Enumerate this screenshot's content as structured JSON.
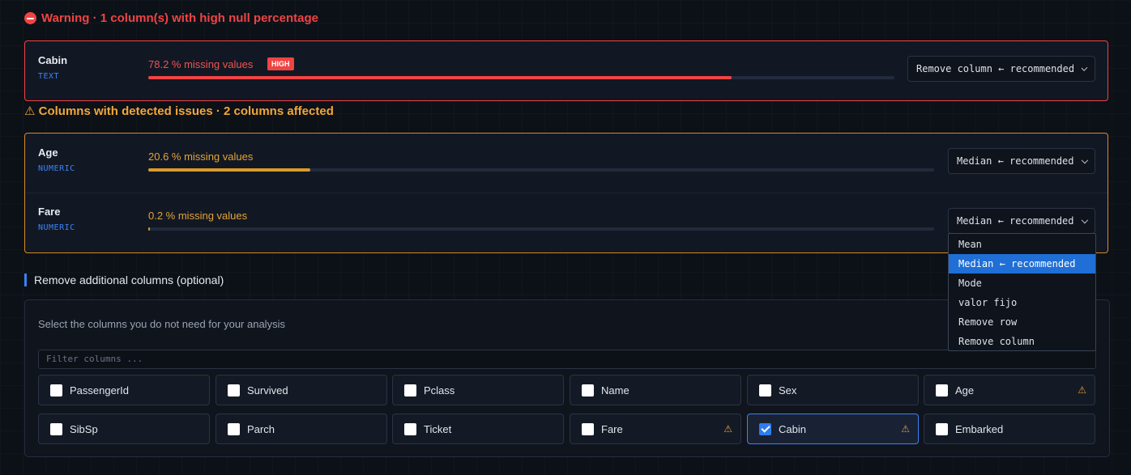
{
  "warning_section": {
    "title": "Warning · 1 column(s) with high null percentage",
    "columns": [
      {
        "name": "Cabin",
        "type": "TEXT",
        "missing_text": "78.2 % missing values",
        "missing_fraction": 0.782,
        "badge": "HIGH",
        "action": "Remove column ← recommended"
      }
    ]
  },
  "issues_section": {
    "title": "⚠ Columns with detected issues · 2 columns affected",
    "columns": [
      {
        "name": "Age",
        "type": "NUMERIC",
        "missing_text": "20.6 % missing values",
        "missing_fraction": 0.206,
        "action": "Median ← recommended"
      },
      {
        "name": "Fare",
        "type": "NUMERIC",
        "missing_text": "0.2 % missing values",
        "missing_fraction": 0.002,
        "action": "Median ← recommended"
      }
    ]
  },
  "dropdown": {
    "options": [
      "Mean",
      "Median ← recommended",
      "Mode",
      "valor fijo",
      "Remove row",
      "Remove column"
    ],
    "selected": "Median ← recommended"
  },
  "remove_section": {
    "title": "Remove additional columns (optional)",
    "hint": "Select the columns you do not need for your analysis",
    "filter_placeholder": "Filter columns ...",
    "columns": [
      {
        "name": "PassengerId",
        "checked": false,
        "warning": false
      },
      {
        "name": "Survived",
        "checked": false,
        "warning": false
      },
      {
        "name": "Pclass",
        "checked": false,
        "warning": false
      },
      {
        "name": "Name",
        "checked": false,
        "warning": false
      },
      {
        "name": "Sex",
        "checked": false,
        "warning": false
      },
      {
        "name": "Age",
        "checked": false,
        "warning": true
      },
      {
        "name": "SibSp",
        "checked": false,
        "warning": false
      },
      {
        "name": "Parch",
        "checked": false,
        "warning": false
      },
      {
        "name": "Ticket",
        "checked": false,
        "warning": false
      },
      {
        "name": "Fare",
        "checked": false,
        "warning": true
      },
      {
        "name": "Cabin",
        "checked": true,
        "warning": true
      },
      {
        "name": "Embarked",
        "checked": false,
        "warning": false
      }
    ],
    "warning_glyph": "⚠"
  },
  "colors": {
    "danger": "#ef4444",
    "warning": "#f2a63a",
    "accent": "#3b82f6"
  }
}
